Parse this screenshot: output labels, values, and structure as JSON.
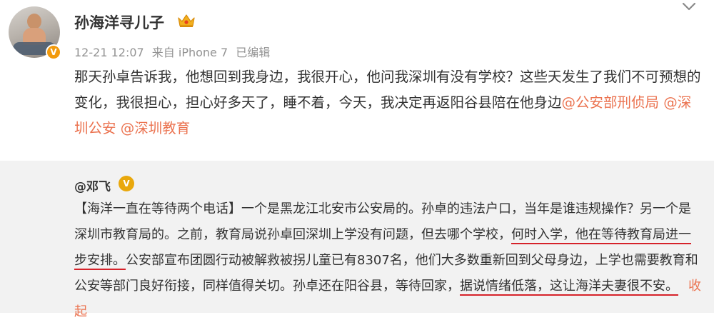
{
  "post": {
    "username": "孙海洋寻儿子",
    "timestamp": "12-21 12:07",
    "source": "来自 iPhone 7",
    "edited": "已编辑",
    "text_part1": "那天孙卓告诉我，他想回到我身边，我很开心，他问我深圳有没有学校？这些天发生了我们不可预想的变化，我很担心，担心好多天了，睡不着，今天，我决定再返阳谷县陪在他身边",
    "mentions": [
      "@公安部刑侦局",
      "@深圳公安",
      "@深圳教育"
    ]
  },
  "repost": {
    "username": "@邓飞",
    "badge": "V",
    "text_a": "【海洋一直在等待两个电话】一个是黑龙江北安市公安局的。孙卓的违法户口，当年是谁违规操作？另一个是深圳市教育局的。之前，教育局说孙卓回深圳上学没有问题，但去哪个学校，",
    "text_b": "何时入学，他在等待教育局进一步安排。",
    "text_c": "公安部宣布团圆行动被解救被拐儿童已有8307名，他们大多数重新回到父母身边，上学也需要教育和公安等部门良好衔接，同样值得关切。孙卓还在阳谷县，等待回家，",
    "text_d": "据说情绪低落，这让海洋夫妻很不安。",
    "collapse_label": "收起"
  },
  "icons": {
    "verified_badge": "V",
    "crown": "crown-icon",
    "dropdown": "chevron-down-icon"
  },
  "colors": {
    "link": "#eb7350",
    "underline": "#d6222a",
    "repost_bg": "#f2f2f2",
    "badge": "#f29a0c"
  }
}
